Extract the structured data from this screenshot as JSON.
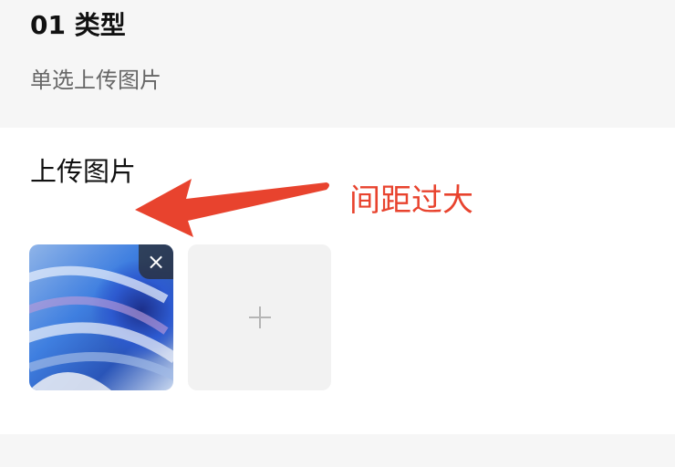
{
  "section": {
    "title": "01 类型",
    "description": "单选上传图片"
  },
  "upload": {
    "label": "上传图片",
    "images": [
      {
        "delete_label": "×"
      }
    ],
    "add_label": "+"
  },
  "annotation": {
    "text": "间距过大",
    "color": "#e8432e"
  }
}
